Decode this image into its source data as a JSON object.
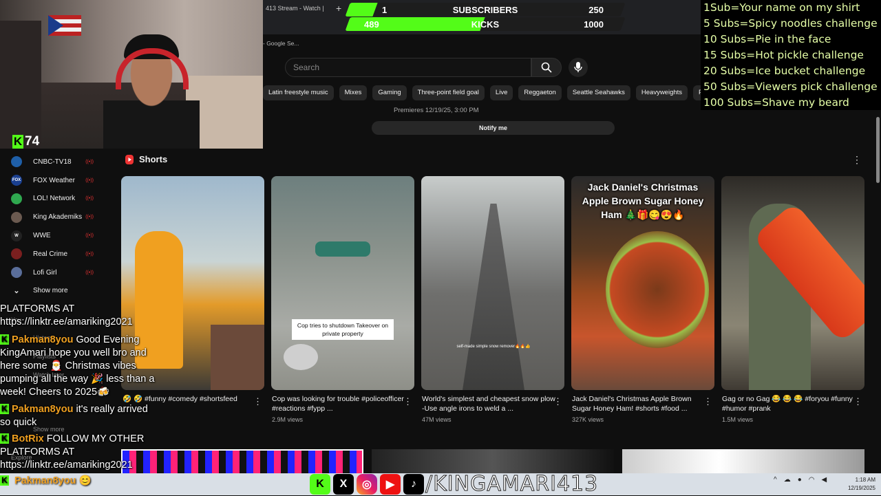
{
  "browser": {
    "tab_title": "413 Stream - Watch |",
    "new_tab": "+",
    "bookmark": "- Google Se..."
  },
  "goals": {
    "subscribers": {
      "label": "SUBSCRIBERS",
      "current": "1",
      "target": "250",
      "progress": 0.004
    },
    "kicks": {
      "label": "KICKS",
      "current": "489",
      "target": "1000",
      "progress": 0.489
    },
    "accent": "#53fc18"
  },
  "webcam": {
    "kick_logo": "K",
    "viewer_count": "74"
  },
  "search": {
    "placeholder": "Search"
  },
  "chips": [
    "Latin freestyle music",
    "Mixes",
    "Gaming",
    "Three-point field goal",
    "Live",
    "Reggaeton",
    "Seattle Seahawks",
    "Heavyweights",
    "Punc"
  ],
  "premiere": {
    "text": "Premieres 12/19/25, 3:00 PM",
    "button": "Notify me"
  },
  "sub_goals": [
    "1Sub=Your name on my shirt",
    "5 Subs=Spicy noodles challenge",
    "10 Subs=Pie in the face",
    "15 Subs=Hot pickle challenge",
    "20 Subs=Ice bucket challenge",
    "50 Subs=Viewers pick challenge",
    "100 Subs=Shave my beard"
  ],
  "sidebar": {
    "items": [
      {
        "label": "CNBC-TV18",
        "color": "#1f5fa8",
        "badge": ""
      },
      {
        "label": "FOX Weather",
        "color": "#1a3f8f",
        "badge": "FOX"
      },
      {
        "label": "LOL! Network",
        "color": "#2fa84f",
        "badge": ""
      },
      {
        "label": "King Akademiks",
        "color": "#6b5a50",
        "badge": ""
      },
      {
        "label": "WWE",
        "color": "#222222",
        "badge": "W"
      },
      {
        "label": "Real Crime",
        "color": "#7a1f1f",
        "badge": ""
      },
      {
        "label": "Lofi Girl",
        "color": "#5a6e9a",
        "badge": ""
      }
    ],
    "show_more": "Show more",
    "ghost_labels": [
      "You",
      "History",
      "Playlists",
      "Watch later",
      "Show more",
      "Explore"
    ]
  },
  "shorts": {
    "header": "Shorts",
    "items": [
      {
        "title": "🤣 🤣 #funny #comedy #shortsfeed",
        "views": "",
        "caption": "",
        "big_caption": "",
        "tiny_caption": ""
      },
      {
        "title": "Cop was looking for trouble #policeofficer #reactions #fypp ...",
        "views": "2.9M views",
        "caption": "Cop tries to shutdown Takeover on private property",
        "big_caption": "",
        "tiny_caption": ""
      },
      {
        "title": "World's simplest and cheapest snow plow -Use angle irons to weld a ...",
        "views": "47M views",
        "caption": "",
        "big_caption": "",
        "tiny_caption": "self-made simple snow remover🔥🔥👍"
      },
      {
        "title": "Jack Daniel's Christmas Apple Brown Sugar Honey Ham! #shorts #food ...",
        "views": "327K views",
        "caption": "",
        "big_caption": "Jack Daniel's Christmas Apple Brown Sugar Honey Ham 🎄🎁😋😍🔥",
        "tiny_caption": ""
      },
      {
        "title": "Gag or no Gag 😂 😂 😂 #foryou #funny #humor #prank",
        "views": "1.5M views",
        "caption": "",
        "big_caption": "",
        "tiny_caption": ""
      }
    ]
  },
  "chat": {
    "lines": [
      {
        "text": "PLATFORMS AT"
      },
      {
        "text": "https://linktr.ee/amariking2021"
      },
      {
        "user": "Pakman8you",
        "text": " Good Evening"
      },
      {
        "text": "KingAmari hope you well bro and"
      },
      {
        "text": "here some 🎅 Christmas vibes"
      },
      {
        "text": "pumping all the way 🎉 less than a"
      },
      {
        "text": "week! Cheers to 2025🍻"
      },
      {
        "user": "Pakman8you",
        "text": " it's really arrived"
      },
      {
        "text": "so quick"
      },
      {
        "user": "BotRix",
        "text": " FOLLOW MY OTHER"
      },
      {
        "text": "PLATFORMS AT"
      },
      {
        "text": "https://linktr.ee/amariking2021"
      },
      {
        "user": "Pakman8you",
        "text": " 😊"
      }
    ]
  },
  "social_bar": {
    "handle": "/KINGAMARI413",
    "icons": [
      "kick-icon",
      "x-icon",
      "instagram-icon",
      "youtube-icon",
      "tiktok-icon"
    ]
  },
  "taskbar": {
    "time": "1:18 AM",
    "date": "12/19/2025"
  }
}
